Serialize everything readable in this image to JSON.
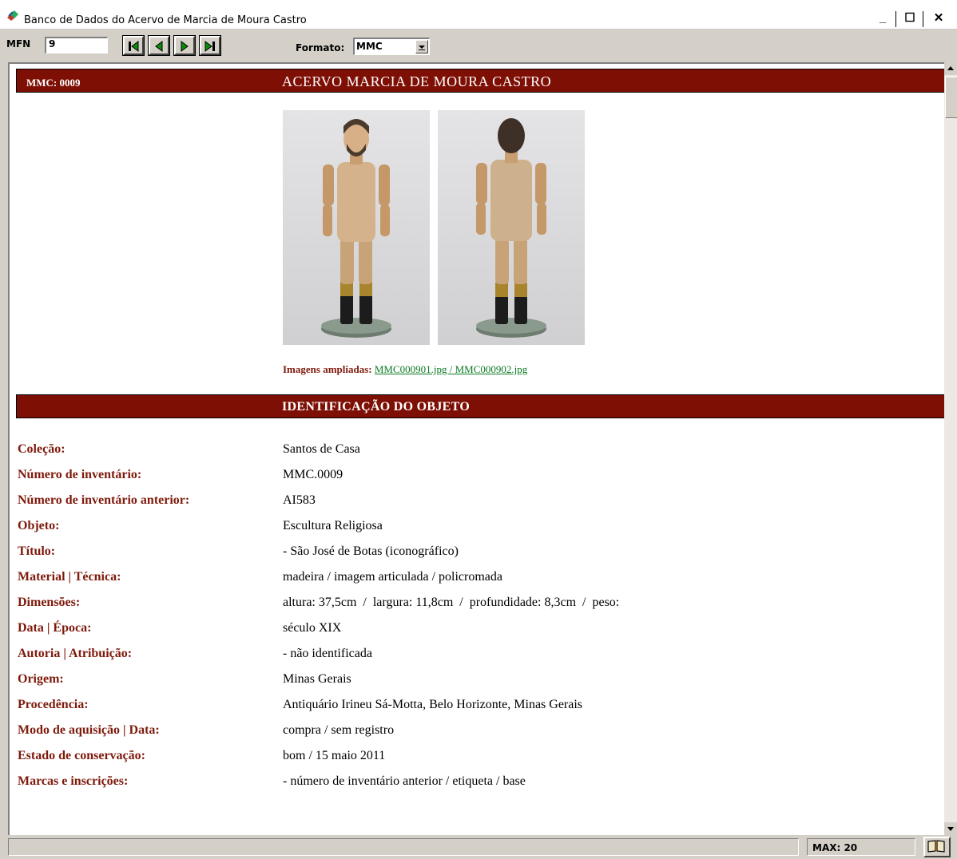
{
  "window": {
    "title": "Banco de Dados do Acervo de Marcia de Moura Castro",
    "minimize": "_",
    "maximize": "☐",
    "close": "✕"
  },
  "toolbar": {
    "mfn_label": "MFN",
    "mfn_value": "9",
    "format_label": "Formato:",
    "format_value": "MMC",
    "nav_buttons": [
      "first-record-icon",
      "previous-record-icon",
      "next-record-icon",
      "last-record-icon"
    ]
  },
  "record": {
    "code": "MMC: 0009",
    "collection_title": "ACERVO MARCIA DE MOURA CASTRO",
    "images_label": "Imagens ampliadas:",
    "images_links": "MMC000901.jpg / MMC000902.jpg",
    "section_title": "IDENTIFICAÇÃO DO OBJETO",
    "fields": [
      {
        "label": "Coleção:",
        "value": "Santos de Casa"
      },
      {
        "label": "Número de inventário:",
        "value": "MMC.0009"
      },
      {
        "label": "Número de inventário anterior:",
        "value": "AI583"
      },
      {
        "label": "Objeto:",
        "value": "Escultura Religiosa"
      },
      {
        "label": "Título:",
        "value": "- São José de Botas (iconográfico)"
      },
      {
        "label": "Material | Técnica:",
        "value": "madeira / imagem articulada / policromada"
      },
      {
        "label": "Dimensões:",
        "value": "altura: 37,5cm  /  largura: 11,8cm  /  profundidade: 8,3cm  /  peso:"
      },
      {
        "label": "Data | Época:",
        "value": "século XIX"
      },
      {
        "label": "Autoria | Atribuição:",
        "value": "- não identificada"
      },
      {
        "label": "Origem:",
        "value": "Minas Gerais"
      },
      {
        "label": "Procedência:",
        "value": "Antiquário Irineu Sá-Motta, Belo Horizonte, Minas Gerais"
      },
      {
        "label": "Modo de aquisição | Data:",
        "value": "compra / sem registro"
      },
      {
        "label": "Estado de conservação:",
        "value": "bom / 15 maio 2011"
      },
      {
        "label": "Marcas e inscrições:",
        "value": "- número de inventário anterior / etiqueta / base"
      }
    ]
  },
  "status": {
    "max": "MAX: 20"
  },
  "colors": {
    "banner": "#7e0f05",
    "label": "#7e1a0c",
    "link": "#0a7a20"
  }
}
